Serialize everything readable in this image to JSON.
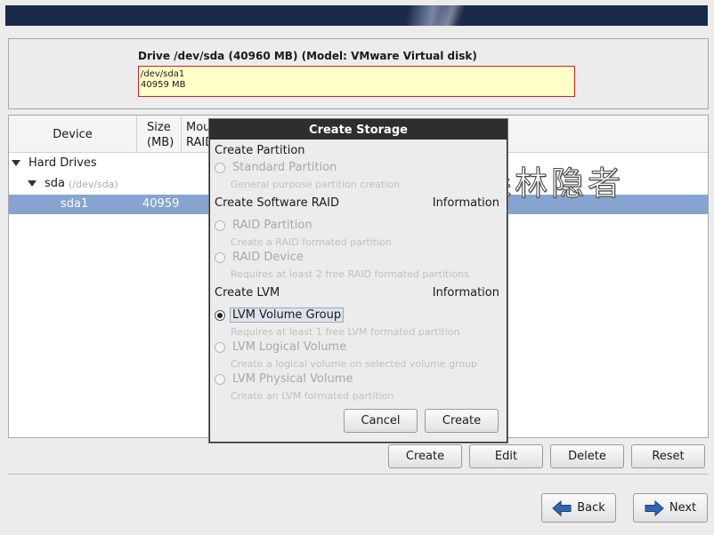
{
  "drive": {
    "title": "Drive /dev/sda (40960 MB) (Model: VMware Virtual disk)",
    "partition_name": "/dev/sda1",
    "partition_size": "40959 MB"
  },
  "tree": {
    "headers": {
      "device": "Device",
      "size_line1": "Size",
      "size_line2": "(MB)",
      "mount_line1": "Mou",
      "mount_line2": "RAID"
    },
    "rows": {
      "hard_drives": "Hard Drives",
      "sda": "sda",
      "sda_path": "(/dev/sda)",
      "sda1": "sda1",
      "sda1_size": "40959"
    }
  },
  "modal": {
    "title": "Create Storage",
    "create_partition": "Create Partition",
    "standard_partition": "Standard Partition",
    "standard_partition_desc": "General purpose partition creation",
    "create_software_raid": "Create Software RAID",
    "raid_information": "Information",
    "raid_partition": "RAID Partition",
    "raid_partition_desc": "Create a RAID formated partition",
    "raid_device": "RAID Device",
    "raid_device_desc": "Requires at least 2 free RAID formated partitions",
    "create_lvm": "Create LVM",
    "lvm_information": "Information",
    "lvm_volume_group": "LVM Volume Group",
    "lvm_volume_group_desc": "Requires at least 1 free LVM formated partition",
    "lvm_logical_volume": "LVM Logical Volume",
    "lvm_logical_volume_desc": "Create a logical volume on selected volume group",
    "lvm_physical_volume": "LVM Physical Volume",
    "lvm_physical_volume_desc": "Create an LVM formated partition",
    "cancel": "Cancel",
    "create": "Create"
  },
  "toolbar": {
    "create": "Create",
    "edit": "Edit",
    "delete": "Delete",
    "reset": "Reset"
  },
  "nav": {
    "back": "Back",
    "next": "Next"
  },
  "watermark": "森林隐者",
  "colors": {
    "selection": "#86a4cf",
    "modal_title_bg": "#2e2e2e",
    "drive_bar_bg": "#ffffc8",
    "drive_bar_border": "#d02020",
    "arrow_blue": "#2f64b4"
  }
}
